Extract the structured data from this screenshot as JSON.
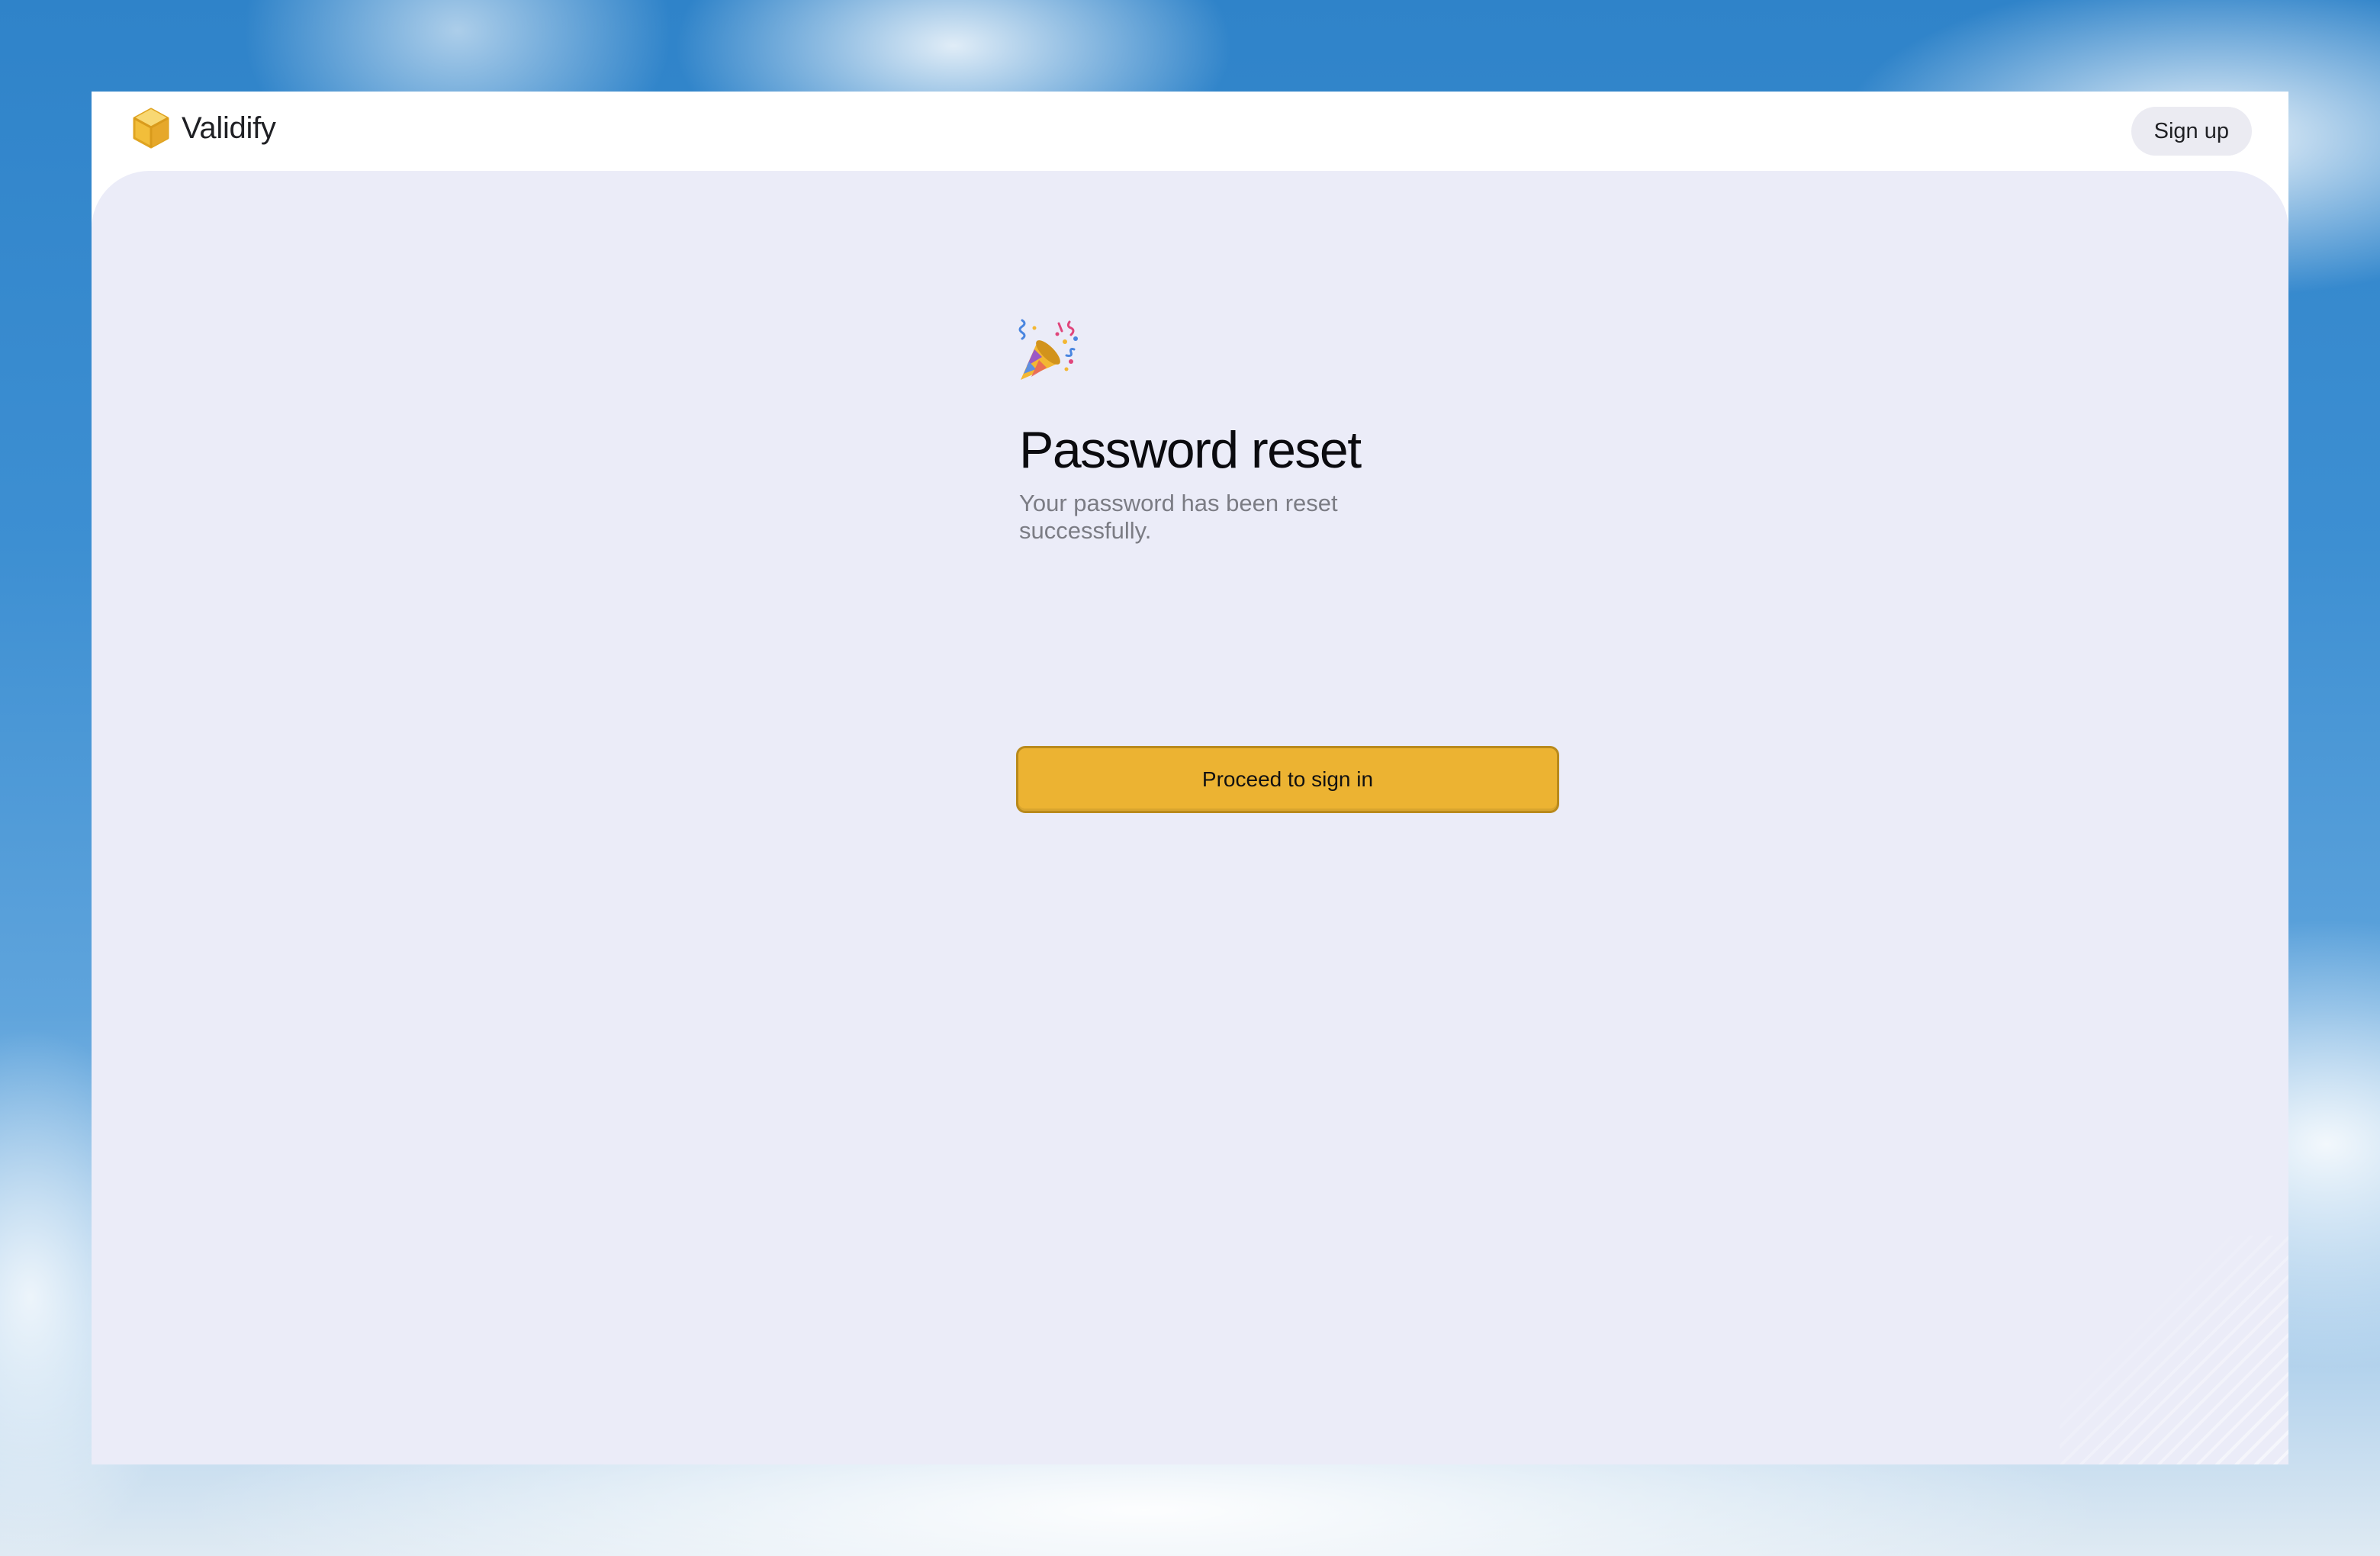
{
  "brand": {
    "name": "Validify",
    "icon": "cube-icon",
    "accent_color": "#ecb332"
  },
  "header": {
    "signup_label": "Sign up"
  },
  "main": {
    "icon": "party-popper-icon",
    "title": "Password reset",
    "subtitle": "Your password has been reset successfully.",
    "primary_button_label": "Proceed to sign in"
  },
  "colors": {
    "content_background": "#ebecf8",
    "primary_button": "#ecb332",
    "subtitle_text": "#7b7c84"
  }
}
